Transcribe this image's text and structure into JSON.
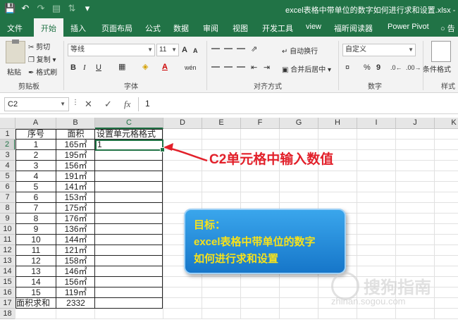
{
  "titlebar": {
    "doc_title": "excel表格中带单位的数字如何进行求和设置.xlsx - E",
    "icons": [
      "save-icon",
      "undo-icon",
      "redo-icon",
      "print-preview-icon",
      "sort-icon",
      "customize-qat-icon"
    ]
  },
  "tabs": [
    "文件",
    "开始",
    "插入",
    "页面布局",
    "公式",
    "数据",
    "审阅",
    "视图",
    "开发工具",
    "view",
    "福昕阅读器",
    "Power Pivot",
    "告"
  ],
  "active_tab": "开始",
  "ribbon": {
    "clipboard": {
      "paste": "粘贴",
      "cut": "剪切",
      "copy": "复制",
      "format_painter": "格式刷",
      "label": "剪贴板"
    },
    "font": {
      "name": "等线",
      "size": "11",
      "grow": "A",
      "shrink": "A",
      "bold": "B",
      "italic": "I",
      "underline": "U",
      "font_color": "A",
      "phonetic": "wén",
      "label": "字体"
    },
    "alignment": {
      "wrap": "自动换行",
      "merge": "合并后居中",
      "label": "对齐方式"
    },
    "number": {
      "format": "自定义",
      "percent": "%",
      "comma": "9",
      "label": "数字"
    },
    "styles": {
      "conditional": "条件格式",
      "style_label": "样式"
    }
  },
  "formula_bar": {
    "cell_ref": "C2",
    "cancel": "✕",
    "enter": "✓",
    "fx": "fx",
    "value": "1"
  },
  "columns": [
    "A",
    "B",
    "C",
    "D",
    "E",
    "F",
    "G",
    "H",
    "I",
    "J",
    "K"
  ],
  "rows": [
    "1",
    "2",
    "3",
    "4",
    "5",
    "6",
    "7",
    "8",
    "9",
    "10",
    "11",
    "12",
    "13",
    "14",
    "15",
    "16",
    "17",
    "18"
  ],
  "table": {
    "headers": [
      "序号",
      "面积",
      "设置单元格格式"
    ],
    "data": [
      [
        "1",
        "165㎡",
        "1"
      ],
      [
        "2",
        "195㎡",
        ""
      ],
      [
        "3",
        "156㎡",
        ""
      ],
      [
        "4",
        "191㎡",
        ""
      ],
      [
        "5",
        "141㎡",
        ""
      ],
      [
        "6",
        "153㎡",
        ""
      ],
      [
        "7",
        "175㎡",
        ""
      ],
      [
        "8",
        "176㎡",
        ""
      ],
      [
        "9",
        "136㎡",
        ""
      ],
      [
        "10",
        "144㎡",
        ""
      ],
      [
        "11",
        "121㎡",
        ""
      ],
      [
        "12",
        "158㎡",
        ""
      ],
      [
        "13",
        "146㎡",
        ""
      ],
      [
        "14",
        "156㎡",
        ""
      ],
      [
        "15",
        "119㎡",
        ""
      ]
    ],
    "total_label": "面积求和",
    "total_value": "2332"
  },
  "selected_cell": "C2",
  "annotation": {
    "callout": "C2单元格中输入数值",
    "goal_lines": [
      "目标：",
      "excel表格中带单位的数字",
      "如何进行求和设置"
    ],
    "callout_color": "#e2202a",
    "box_text_color": "#f7e21b"
  },
  "watermark": {
    "brand": "搜狗指南",
    "url": "zhinan.sogou.com"
  },
  "colors": {
    "excel_green": "#217346",
    "ribbon_bg": "#f3f3f3"
  }
}
